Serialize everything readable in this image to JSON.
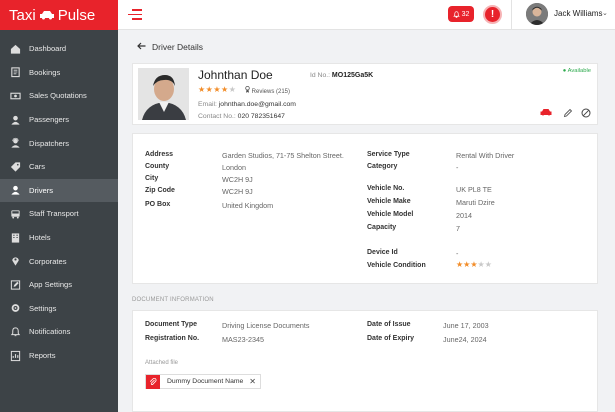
{
  "brand": {
    "name_left": "Taxi",
    "name_right": "Pulse"
  },
  "header": {
    "notifications_count": "32",
    "alert_glyph": "!",
    "user_name": "Jack Williams",
    "accent": "#e8232b"
  },
  "sidebar": {
    "items": [
      {
        "label": "Dashboard",
        "icon": "home-icon"
      },
      {
        "label": "Bookings",
        "icon": "clipboard-icon"
      },
      {
        "label": "Sales Quotations",
        "icon": "money-icon"
      },
      {
        "label": "Passengers",
        "icon": "user-icon"
      },
      {
        "label": "Dispatchers",
        "icon": "dispatcher-icon"
      },
      {
        "label": "Cars",
        "icon": "tag-icon"
      },
      {
        "label": "Drivers",
        "icon": "driver-icon"
      },
      {
        "label": "Staff Transport",
        "icon": "bus-icon"
      },
      {
        "label": "Hotels",
        "icon": "hotel-icon"
      },
      {
        "label": "Corporates",
        "icon": "pin-icon"
      },
      {
        "label": "App Settings",
        "icon": "edit-icon"
      },
      {
        "label": "Settings",
        "icon": "gear-icon"
      },
      {
        "label": "Notifications",
        "icon": "bell-icon"
      },
      {
        "label": "Reports",
        "icon": "report-icon"
      }
    ],
    "active": "Drivers"
  },
  "page": {
    "title": "Driver Details"
  },
  "profile": {
    "name": "Johnthan Doe",
    "id_label": "Id No.:",
    "id_value": "MO125Ga5K",
    "rating": 4,
    "rating_max": 5,
    "reviews": "Reviews (215)",
    "email_label": "Email:",
    "email": "johnthan.doe@gmail.com",
    "contact_label": "Contact No.:",
    "contact": "020 782351647",
    "status": "Available"
  },
  "details": {
    "left": [
      {
        "label": "Address",
        "value": "Garden Studios, 71-75 Shelton Street."
      },
      {
        "label": "County",
        "value": "London"
      },
      {
        "label": "City",
        "value": "WC2H 9J"
      },
      {
        "label": "Zip Code",
        "value": "WC2H 9J"
      },
      {
        "label": "PO Box",
        "value": "United Kingdom"
      }
    ],
    "right": [
      {
        "label": "Service Type",
        "value": "Rental With Driver"
      },
      {
        "label": "Category",
        "value": "-"
      },
      {
        "label": "Vehicle No.",
        "value": "UK PL8 TE"
      },
      {
        "label": "Vehicle Make",
        "value": "Maruti Dzire"
      },
      {
        "label": "Vehicle Model",
        "value": "2014"
      },
      {
        "label": "Capacity",
        "value": "7"
      },
      {
        "label": "Device Id",
        "value": "-"
      },
      {
        "label": "Vehicle Condition",
        "value": ""
      }
    ],
    "vehicle_condition_rating": 3,
    "vehicle_condition_max": 5
  },
  "documents": {
    "section_title": "DOCUMENT INFORMATION",
    "left": [
      {
        "label": "Document Type",
        "value": "Driving License Documents"
      },
      {
        "label": "Registration No.",
        "value": "MAS23-2345"
      }
    ],
    "right": [
      {
        "label": "Date of Issue",
        "value": "June 17, 2003"
      },
      {
        "label": "Date of Expiry",
        "value": "June24, 2024"
      }
    ],
    "attached_label": "Attached file",
    "attached_file": "Dummy Document Name"
  }
}
